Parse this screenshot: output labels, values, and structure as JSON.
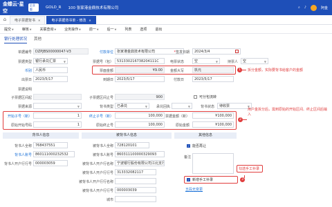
{
  "topbar": {
    "logo": "金蝶云·星空",
    "logo_badge": "企业版",
    "org": "GOLD_R",
    "account": "100 张家港金鼎技术有限公司",
    "user": "阿金"
  },
  "tabs": {
    "home": "⌂",
    "t1": "电子票据背书",
    "t2": "电子票据背书单 - 修改"
  },
  "toolbar": [
    "提交",
    "审核",
    "关联查询",
    "业务操作",
    "前一",
    "后一",
    "列表",
    "选项",
    "退出"
  ],
  "subtabs": [
    "银行处理状况",
    "其他"
  ],
  "form": {
    "bill_no_l": "单据编号",
    "bill_no": "DZPJBS00000047-V3",
    "payer_l": "付款单位",
    "payer": "张家港金鼎技术有限公司",
    "issue_date_l": "签发日期",
    "issue_date": "2024/3/4",
    "bill_type_l": "票据类型",
    "bill_type": "银行承兑汇票",
    "bill_code_l": "票据号（包）",
    "bill_code": "531330216738204111C",
    "status_l": "电票状态",
    "status": "空",
    "holder_l": "持票人",
    "holder": "空",
    "currency_l": "币别",
    "currency": "人民币",
    "amount_l": "票面金额",
    "amount": "¥9.00",
    "amount_cn_l": "金额大写",
    "amount_cn": "玖元",
    "draw_date_l": "出票日",
    "draw_date": "2023/5/17",
    "due_l": "到期日",
    "due": "2023/5/17",
    "pay_date_l": "付款日",
    "pay_date": "2023/5/17",
    "remark_l": "票据说明",
    "subbill_l": "子票据区间起",
    "subbill_end_l": "子票据区间止号",
    "subbill_end": "900",
    "flag_l": "可分包流转",
    "bank_l": "票据来源",
    "bank2_l": "背书类型",
    "bank2": "已承兑",
    "claim_l": "承兑回执",
    "claim2_l": "背书状态",
    "claim2": "待收票",
    "sub_start_l": "开始子号（新）",
    "sub_start": "1",
    "sub_end_l": "终止子号（新）",
    "sub_end": "100,000",
    "sub_amt_l": "票据金额（新）",
    "sub_amt": "¥100,000",
    "orig_start_l": "原始开始号码",
    "orig_start": "1",
    "orig_end_l": "原始终止号",
    "orig_end": "100,000",
    "orig_amt_l": "原始金额",
    "orig_amt": "¥100,000"
  },
  "notes": {
    "n1": "拆分金额，实际要背书给客户的金额",
    "n2": "用户金拆分后，需到原始的开始区间、终止区间后输入",
    "n3": "勾选手工补录"
  },
  "sections": {
    "endorser": "背书人信息",
    "endorsee": "被背书人信息",
    "other": "其他信息"
  },
  "endorser": {
    "acct_l": "背书人全称",
    "acct": "768437551",
    "no_l": "背书人账号",
    "no": "860111000232532",
    "bank_l": "背书人开户行行号",
    "bank": "000003059"
  },
  "endorsee": {
    "name_l": "被背书人全称",
    "name": "728120101",
    "no_l": "被背书人账号",
    "no": "860311100000329093",
    "bank_l": "被背书人开户行名称",
    "bank": "宁波银行股份有限公司江北支行",
    "bankno_l": "被背书人开户行行号",
    "bankno": "313332082117",
    "bank2_l": "被背书人开户行行名称",
    "bank3_l": "被背书人开户行行号",
    "bank3": "000003039",
    "addr_l": "城市"
  },
  "other": {
    "c1": "能否再让",
    "c2_l": "备注",
    "c3": "新增手工补录",
    "link": "五段无变更"
  }
}
